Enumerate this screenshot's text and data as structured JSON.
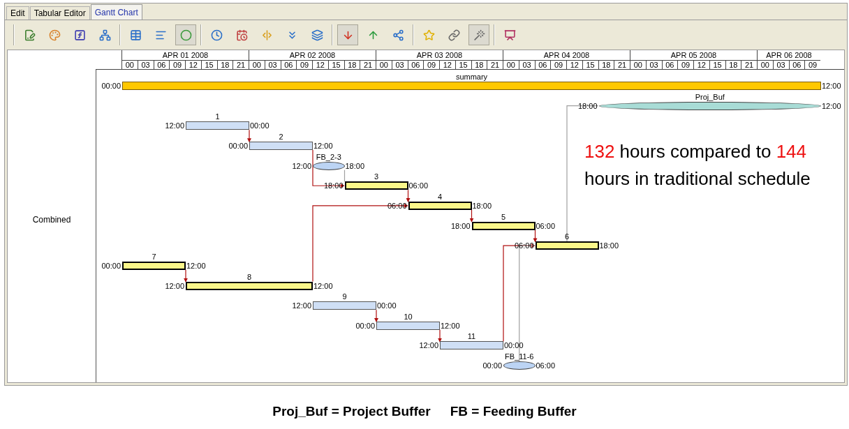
{
  "tabs": [
    {
      "label": "Edit",
      "selected": false
    },
    {
      "label": "Tabular Editor",
      "selected": false
    },
    {
      "label": "Gantt Chart",
      "selected": true
    }
  ],
  "toolbar": {
    "groups": [
      [
        {
          "pressed": false
        },
        {
          "pressed": false
        },
        {
          "pressed": false
        },
        {
          "pressed": false
        }
      ],
      [
        {
          "pressed": false
        },
        {
          "pressed": false
        },
        {
          "pressed": true
        }
      ],
      [
        {
          "pressed": false
        },
        {
          "pressed": false
        },
        {
          "pressed": false
        },
        {
          "pressed": false
        },
        {
          "pressed": false
        }
      ],
      [
        {
          "pressed": true
        },
        {
          "pressed": false
        },
        {
          "pressed": false
        }
      ],
      [
        {
          "pressed": false
        },
        {
          "pressed": false
        },
        {
          "pressed": true
        }
      ],
      [
        {
          "pressed": false
        }
      ]
    ]
  },
  "timeline": {
    "days": [
      {
        "label": "APR 01 2008",
        "hours": [
          "00",
          "03",
          "06",
          "09",
          "12",
          "15",
          "18",
          "21"
        ]
      },
      {
        "label": "APR 02 2008",
        "hours": [
          "00",
          "03",
          "06",
          "09",
          "12",
          "15",
          "18",
          "21"
        ]
      },
      {
        "label": "APR 03 2008",
        "hours": [
          "00",
          "03",
          "06",
          "09",
          "12",
          "15",
          "18",
          "21"
        ]
      },
      {
        "label": "APR 04 2008",
        "hours": [
          "00",
          "03",
          "06",
          "09",
          "12",
          "15",
          "18",
          "21"
        ]
      },
      {
        "label": "APR 05 2008",
        "hours": [
          "00",
          "03",
          "06",
          "09",
          "12",
          "15",
          "18",
          "21"
        ]
      },
      {
        "label": "APR 06 2008",
        "hours": [
          "00",
          "03",
          "06",
          "09"
        ]
      }
    ]
  },
  "resource": {
    "label": "Combined"
  },
  "tasks": [
    {
      "name": "summary",
      "kind": "summary",
      "start": "00:00",
      "end": "12:00"
    },
    {
      "name": "Proj_Buf",
      "kind": "project_buffer",
      "start": "18:00",
      "end": "12:00"
    },
    {
      "name": "1",
      "kind": "task",
      "critical": false,
      "start": "12:00",
      "end": "00:00"
    },
    {
      "name": "2",
      "kind": "task",
      "critical": false,
      "start": "00:00",
      "end": "12:00"
    },
    {
      "name": "FB_2-3",
      "kind": "feeding_buffer",
      "start": "12:00",
      "end": "18:00"
    },
    {
      "name": "3",
      "kind": "task",
      "critical": true,
      "start": "18:00",
      "end": "06:00"
    },
    {
      "name": "4",
      "kind": "task",
      "critical": true,
      "start": "06:00",
      "end": "18:00"
    },
    {
      "name": "5",
      "kind": "task",
      "critical": true,
      "start": "18:00",
      "end": "06:00"
    },
    {
      "name": "6",
      "kind": "task",
      "critical": true,
      "start": "06:00",
      "end": "18:00"
    },
    {
      "name": "7",
      "kind": "task",
      "critical": true,
      "start": "00:00",
      "end": "12:00"
    },
    {
      "name": "8",
      "kind": "task",
      "critical": true,
      "start": "12:00",
      "end": "12:00"
    },
    {
      "name": "9",
      "kind": "task",
      "critical": false,
      "start": "12:00",
      "end": "00:00"
    },
    {
      "name": "10",
      "kind": "task",
      "critical": false,
      "start": "00:00",
      "end": "12:00"
    },
    {
      "name": "11",
      "kind": "task",
      "critical": false,
      "start": "12:00",
      "end": "00:00"
    },
    {
      "name": "FB_11-6",
      "kind": "feeding_buffer",
      "start": "00:00",
      "end": "06:00"
    }
  ],
  "annotation": [
    {
      "text": "132",
      "highlight": true
    },
    {
      "text": " hours compared to ",
      "highlight": false
    },
    {
      "text": "144",
      "highlight": true
    },
    {
      "text": " hours in traditional schedule",
      "highlight": false
    }
  ],
  "legend": [
    "Proj_Buf = Project Buffer",
    "FB = Feeding Buffer"
  ]
}
